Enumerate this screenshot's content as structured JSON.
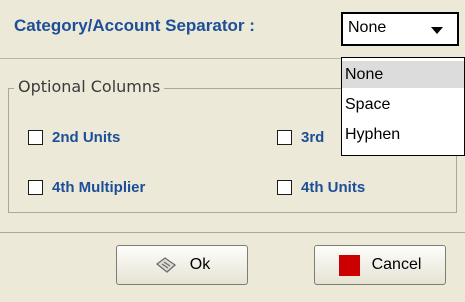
{
  "separator": {
    "label": "Category/Account Separator :",
    "value": "None",
    "options": [
      "None",
      "Space",
      "Hyphen"
    ],
    "highlighted": "None"
  },
  "optional_columns": {
    "title": "Optional Columns",
    "items": [
      {
        "label": "2nd Units",
        "checked": false
      },
      {
        "label": "3rd",
        "checked": false
      },
      {
        "label": "4th Multiplier",
        "checked": false
      },
      {
        "label": "4th Units",
        "checked": false
      }
    ]
  },
  "buttons": {
    "ok": {
      "label": "Ok",
      "icon": "ok-icon"
    },
    "cancel": {
      "label": "Cancel",
      "icon": "cancel-square-icon",
      "icon_color": "#cc0000"
    }
  },
  "colors": {
    "label_blue": "#1c4f97",
    "dialog_bg": "#ece9d8"
  }
}
